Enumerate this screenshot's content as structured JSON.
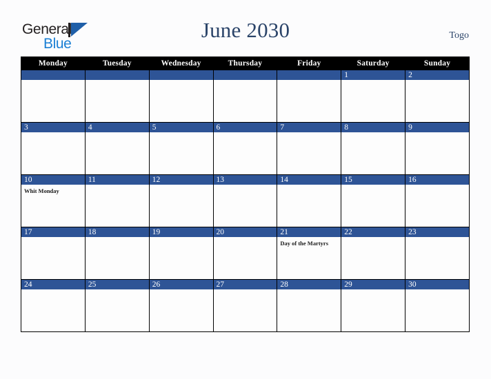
{
  "brand": {
    "name_part1": "General",
    "name_part2": "Blue",
    "color_dark": "#231f20",
    "color_blue": "#1a7fd4",
    "triangle_color": "#1f5fa8"
  },
  "header": {
    "title": "June 2030",
    "country": "Togo",
    "title_color": "#2b4469"
  },
  "calendar": {
    "weekdays": [
      "Monday",
      "Tuesday",
      "Wednesday",
      "Thursday",
      "Friday",
      "Saturday",
      "Sunday"
    ],
    "header_bg": "#000000",
    "daynum_bg": "#2e5496",
    "cell_bg": "#fdfdfd",
    "border_color": "#000000",
    "weeks": [
      [
        {
          "day": "",
          "event": ""
        },
        {
          "day": "",
          "event": ""
        },
        {
          "day": "",
          "event": ""
        },
        {
          "day": "",
          "event": ""
        },
        {
          "day": "",
          "event": ""
        },
        {
          "day": "1",
          "event": ""
        },
        {
          "day": "2",
          "event": ""
        }
      ],
      [
        {
          "day": "3",
          "event": ""
        },
        {
          "day": "4",
          "event": ""
        },
        {
          "day": "5",
          "event": ""
        },
        {
          "day": "6",
          "event": ""
        },
        {
          "day": "7",
          "event": ""
        },
        {
          "day": "8",
          "event": ""
        },
        {
          "day": "9",
          "event": ""
        }
      ],
      [
        {
          "day": "10",
          "event": "Whit Monday"
        },
        {
          "day": "11",
          "event": ""
        },
        {
          "day": "12",
          "event": ""
        },
        {
          "day": "13",
          "event": ""
        },
        {
          "day": "14",
          "event": ""
        },
        {
          "day": "15",
          "event": ""
        },
        {
          "day": "16",
          "event": ""
        }
      ],
      [
        {
          "day": "17",
          "event": ""
        },
        {
          "day": "18",
          "event": ""
        },
        {
          "day": "19",
          "event": ""
        },
        {
          "day": "20",
          "event": ""
        },
        {
          "day": "21",
          "event": "Day of the Martyrs"
        },
        {
          "day": "22",
          "event": ""
        },
        {
          "day": "23",
          "event": ""
        }
      ],
      [
        {
          "day": "24",
          "event": ""
        },
        {
          "day": "25",
          "event": ""
        },
        {
          "day": "26",
          "event": ""
        },
        {
          "day": "27",
          "event": ""
        },
        {
          "day": "28",
          "event": ""
        },
        {
          "day": "29",
          "event": ""
        },
        {
          "day": "30",
          "event": ""
        }
      ]
    ]
  }
}
